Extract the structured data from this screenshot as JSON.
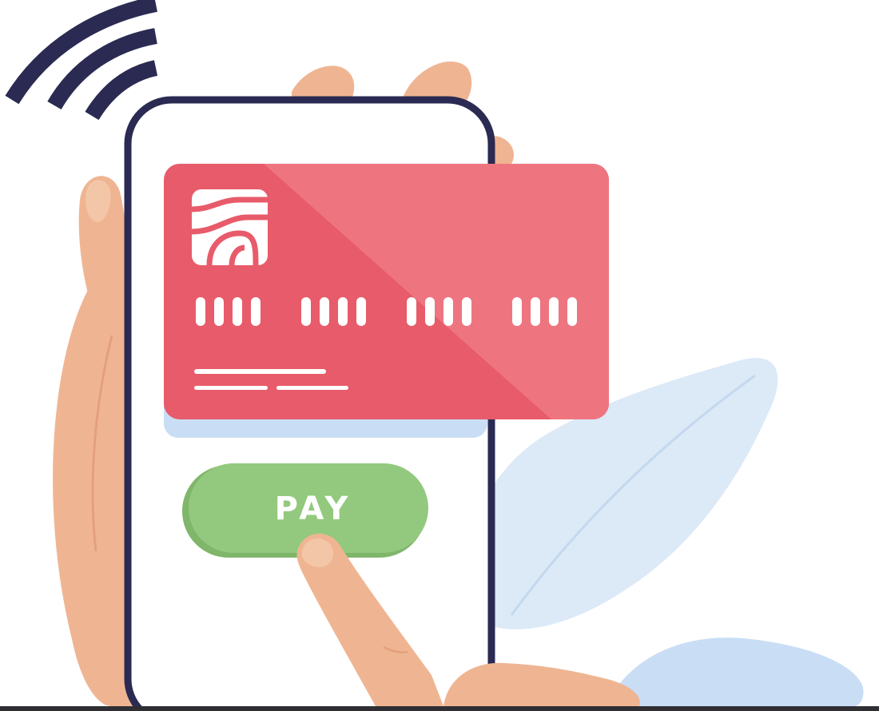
{
  "pay_button": {
    "label": "PAY"
  },
  "card": {
    "number_groups": 4,
    "digits_per_group": 4
  },
  "colors": {
    "navy": "#2a2a52",
    "card_red": "#e85b6a",
    "card_red_light": "#ee7a84",
    "pay_green": "#93c97e",
    "pay_green_dark": "#7fb66a",
    "skin": "#efb592",
    "skin_shadow": "#e3a07c",
    "leaf_blue": "#dce9f7",
    "card_shadow_blue": "#c9def5",
    "white": "#ffffff"
  },
  "icons": {
    "contactless": "contactless-wave-icon",
    "chip": "card-chip-icon"
  }
}
